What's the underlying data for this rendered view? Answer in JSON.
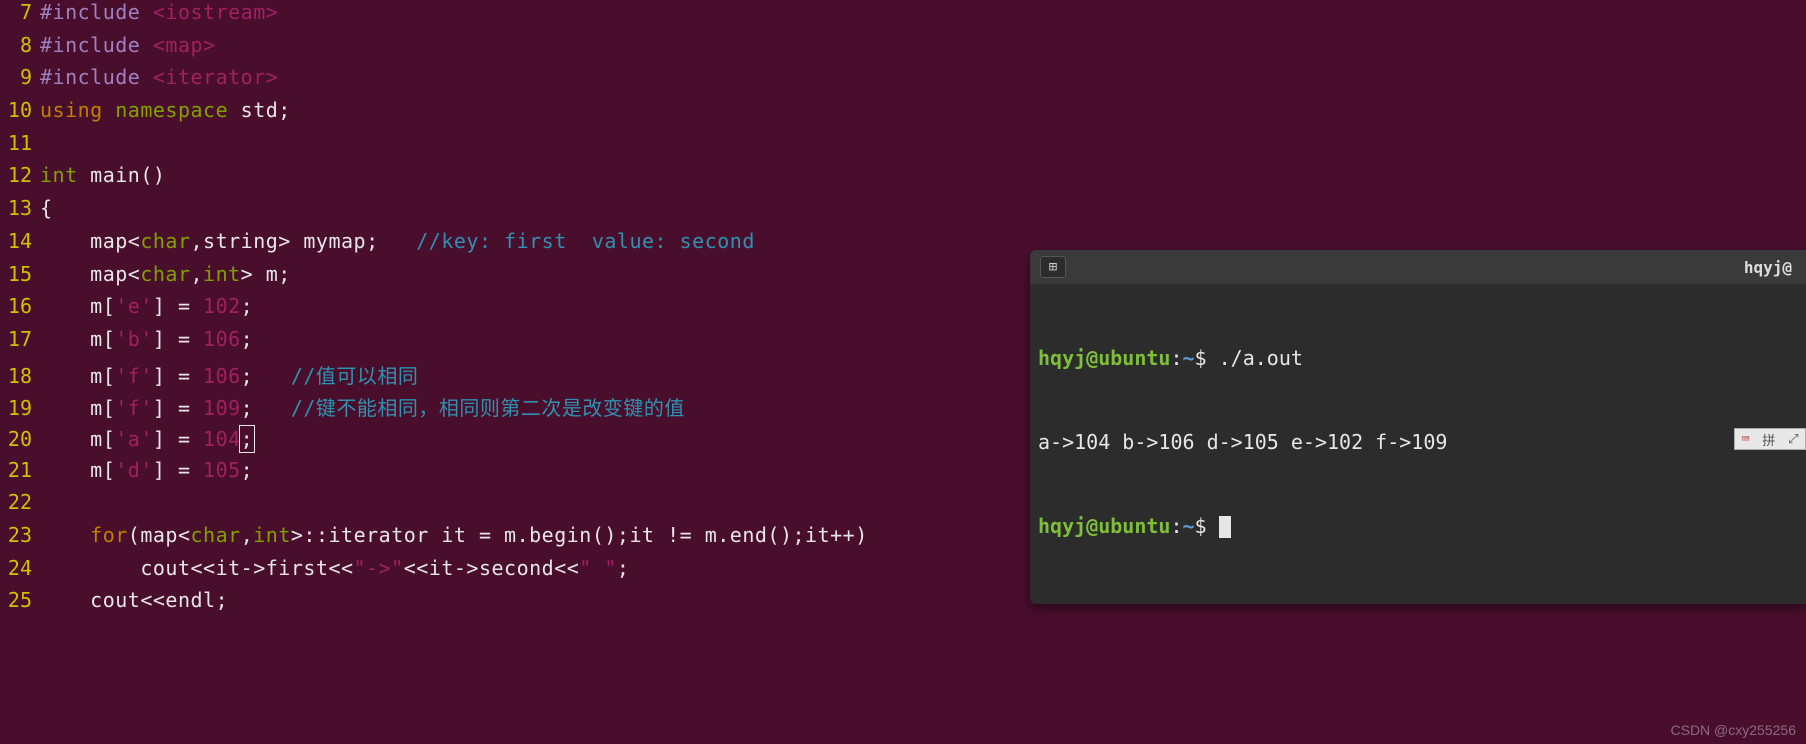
{
  "lines": [
    {
      "n": "7",
      "tokens": [
        [
          "preproc",
          "#include "
        ],
        [
          "angle",
          "<iostream>"
        ]
      ]
    },
    {
      "n": "8",
      "tokens": [
        [
          "preproc",
          "#include "
        ],
        [
          "angle",
          "<map>"
        ]
      ]
    },
    {
      "n": "9",
      "tokens": [
        [
          "preproc",
          "#include "
        ],
        [
          "angle",
          "<iterator>"
        ]
      ]
    },
    {
      "n": "10",
      "tokens": [
        [
          "keyword",
          "using "
        ],
        [
          "type",
          "namespace"
        ],
        [
          "normal",
          " std;"
        ]
      ]
    },
    {
      "n": "11",
      "tokens": []
    },
    {
      "n": "12",
      "tokens": [
        [
          "type",
          "int"
        ],
        [
          "normal",
          " main()"
        ]
      ]
    },
    {
      "n": "13",
      "tokens": [
        [
          "normal",
          "{"
        ]
      ]
    },
    {
      "n": "14",
      "tokens": [
        [
          "normal",
          "    map<"
        ],
        [
          "type",
          "char"
        ],
        [
          "normal",
          ",string> mymap;   "
        ],
        [
          "comment",
          "//key: first  value: second"
        ]
      ]
    },
    {
      "n": "15",
      "tokens": [
        [
          "normal",
          "    map<"
        ],
        [
          "type",
          "char"
        ],
        [
          "normal",
          ","
        ],
        [
          "type",
          "int"
        ],
        [
          "normal",
          "> m;"
        ]
      ]
    },
    {
      "n": "16",
      "tokens": [
        [
          "normal",
          "    m["
        ],
        [
          "string",
          "'e'"
        ],
        [
          "normal",
          "] = "
        ],
        [
          "number",
          "102"
        ],
        [
          "normal",
          ";"
        ]
      ]
    },
    {
      "n": "17",
      "tokens": [
        [
          "normal",
          "    m["
        ],
        [
          "string",
          "'b'"
        ],
        [
          "normal",
          "] = "
        ],
        [
          "number",
          "106"
        ],
        [
          "normal",
          ";"
        ]
      ]
    },
    {
      "n": "18",
      "tokens": [
        [
          "normal",
          "    m["
        ],
        [
          "string",
          "'f'"
        ],
        [
          "normal",
          "] = "
        ],
        [
          "number",
          "106"
        ],
        [
          "normal",
          ";   "
        ],
        [
          "comment",
          "//值可以相同"
        ]
      ]
    },
    {
      "n": "19",
      "tokens": [
        [
          "normal",
          "    m["
        ],
        [
          "string",
          "'f'"
        ],
        [
          "normal",
          "] = "
        ],
        [
          "number",
          "109"
        ],
        [
          "normal",
          ";   "
        ],
        [
          "comment",
          "//键不能相同，相同则第二次是改变键的值"
        ]
      ]
    },
    {
      "n": "20",
      "tokens": [
        [
          "normal",
          "    m["
        ],
        [
          "string",
          "'a'"
        ],
        [
          "normal",
          "] = "
        ],
        [
          "number",
          "104"
        ],
        [
          "cursorbox",
          ";"
        ]
      ]
    },
    {
      "n": "21",
      "tokens": [
        [
          "normal",
          "    m["
        ],
        [
          "string",
          "'d'"
        ],
        [
          "normal",
          "] = "
        ],
        [
          "number",
          "105"
        ],
        [
          "normal",
          ";"
        ]
      ]
    },
    {
      "n": "22",
      "tokens": []
    },
    {
      "n": "23",
      "tokens": [
        [
          "normal",
          "    "
        ],
        [
          "keyword",
          "for"
        ],
        [
          "normal",
          "(map<"
        ],
        [
          "type",
          "char"
        ],
        [
          "normal",
          ","
        ],
        [
          "type",
          "int"
        ],
        [
          "normal",
          ">::iterator it = m.begin();it != m.end();it++)"
        ]
      ]
    },
    {
      "n": "24",
      "tokens": [
        [
          "normal",
          "        cout<<it->first<<"
        ],
        [
          "string",
          "\"->\""
        ],
        [
          "normal",
          "<<it->second<<"
        ],
        [
          "string",
          "\" \""
        ],
        [
          "normal",
          ";"
        ]
      ]
    },
    {
      "n": "25",
      "tokens": [
        [
          "normal",
          "    cout<<endl;"
        ]
      ]
    }
  ],
  "terminal": {
    "title": "hqyj@",
    "prompt_user": "hqyj@ubuntu",
    "prompt_sep": ":",
    "prompt_path": "~",
    "prompt_dollar": "$ ",
    "cmd": "./a.out",
    "output": "a->104 b->106 d->105 e->102 f->109"
  },
  "ime": {
    "icon1": "⌨",
    "icon2": "拼",
    "icon3": "⤢"
  },
  "watermark": "CSDN @cxy255256"
}
